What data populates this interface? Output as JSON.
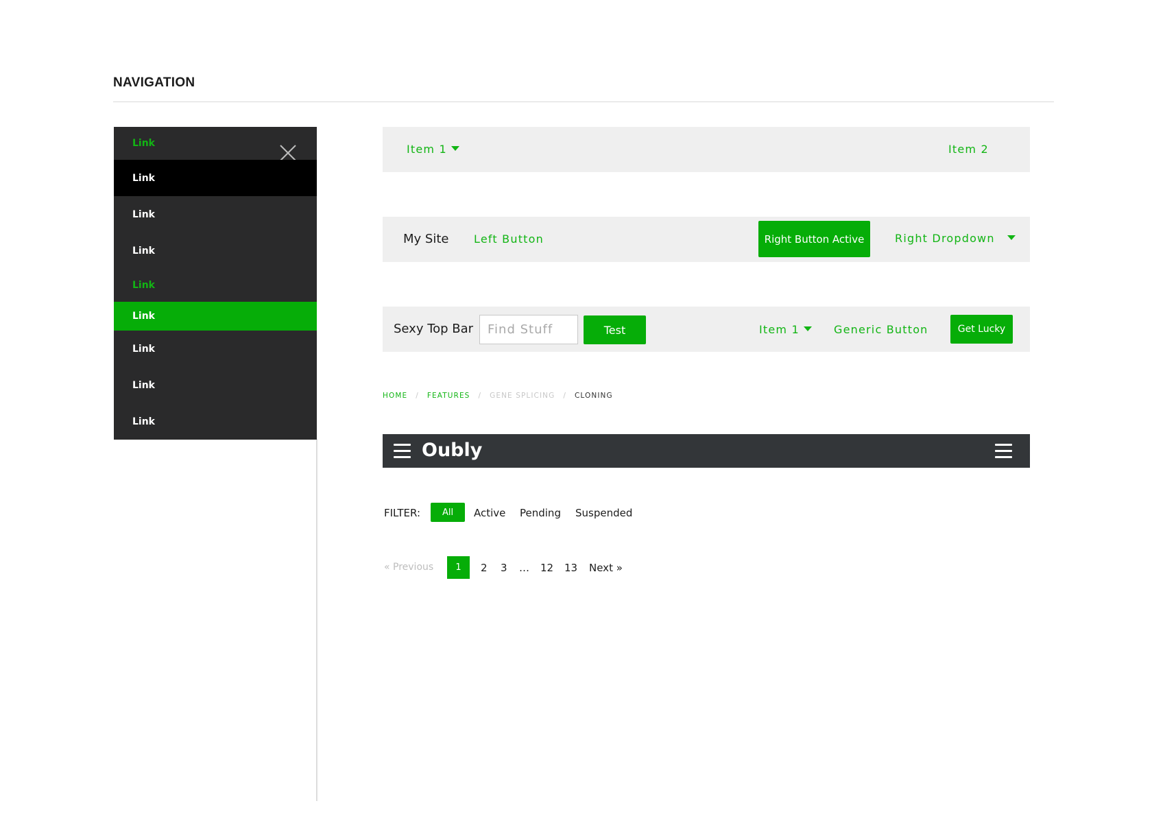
{
  "page": {
    "title": "NAVIGATION"
  },
  "offcanvas": {
    "items": [
      {
        "label": "Link"
      },
      {
        "label": "Link"
      },
      {
        "label": "Link"
      },
      {
        "label": "Link"
      },
      {
        "label": "Link"
      },
      {
        "label": "Link"
      },
      {
        "label": "Link"
      },
      {
        "label": "Link"
      },
      {
        "label": "Link"
      }
    ],
    "close_icon": "close-icon"
  },
  "simple_bar": {
    "item1": "Item 1",
    "item2": "Item 2"
  },
  "site_bar": {
    "brand": "My Site",
    "left_button": "Left Button",
    "right_button_active": "Right Button Active",
    "right_dropdown": "Right Dropdown"
  },
  "top_bar": {
    "brand": "Sexy Top Bar",
    "search_placeholder": "Find Stuff",
    "search_button": "Test",
    "item1": "Item 1",
    "generic_button": "Generic Button",
    "lucky_button": "Get Lucky"
  },
  "breadcrumbs": {
    "items": [
      {
        "label": "HOME"
      },
      {
        "label": "FEATURES"
      },
      {
        "label": "GENE SPLICING"
      },
      {
        "label": "CLONING"
      }
    ],
    "separator": "/"
  },
  "app_bar": {
    "title": "Oubly",
    "left_icon": "hamburger-icon",
    "right_icon": "hamburger-icon"
  },
  "filter": {
    "label": "FILTER:",
    "options": [
      "All",
      "Active",
      "Pending",
      "Suspended"
    ],
    "selected": "All"
  },
  "pagination": {
    "previous": "« Previous",
    "pages": [
      "1",
      "2",
      "3",
      "…",
      "12",
      "13"
    ],
    "current": "1",
    "next": "Next »"
  },
  "colors": {
    "accent": "#06ad08",
    "offcanvas_bg": "#2a2a2b",
    "bar_bg": "#efefef",
    "app_bar_bg": "#333639"
  }
}
